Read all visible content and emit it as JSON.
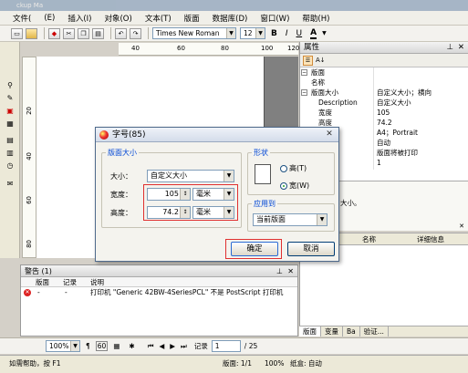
{
  "window": {
    "title_fragment": "ckup Ma"
  },
  "menubar": {
    "items": [
      "文件(",
      "(E)",
      "插入(I)",
      "对象(O)",
      "文本(T)",
      "版面",
      "数据库(D)",
      "窗口(W)",
      "帮助(H)"
    ]
  },
  "toolbar": {
    "font_name": "Times New Roman",
    "font_size": "12",
    "bold": "B",
    "italic": "I",
    "underline": "U",
    "color_a": "A"
  },
  "hruler": {
    "labels": [
      "40",
      "60",
      "80",
      "100",
      "120"
    ]
  },
  "vruler": {
    "labels": [
      "20",
      "40",
      "60",
      "80"
    ]
  },
  "properties": {
    "title": "属性",
    "pin": "ᵃ",
    "close": "✕",
    "rows": [
      {
        "name": "版面",
        "value": "",
        "group": true
      },
      {
        "name": "名称",
        "value": ""
      },
      {
        "name": "版面大小",
        "value": "自定义大小；横向",
        "group": true
      },
      {
        "name": "Description",
        "value": "自定义大小"
      },
      {
        "name": "宽度",
        "value": "105"
      },
      {
        "name": "高度",
        "value": "74.2"
      },
      {
        "name": "",
        "value": "A4；Portrait"
      },
      {
        "name": "",
        "value": "自动"
      },
      {
        "name": "",
        "value": "版面将被打印"
      },
      {
        "name": "",
        "value": "1"
      }
    ],
    "desc_fragment": "大小。"
  },
  "rlower": {
    "col_name": "名称",
    "col_detail": "详细信息",
    "close": "✕"
  },
  "rtabs": [
    "版面",
    "变量",
    "Ba",
    "验证..."
  ],
  "warnings": {
    "title": "警告 (1)",
    "columns": [
      "版面",
      "记录",
      "说明"
    ],
    "row": {
      "page": "-",
      "record": "-",
      "desc": "打印机 \"Generic 42BW-4SeriesPCL\" 不是 PostScript 打印机"
    }
  },
  "bottombar": {
    "zoom": "100%",
    "record_label": "记录",
    "record_value": "1",
    "record_total": "/ 25"
  },
  "statusbar": {
    "help": "如需帮助，按 F1",
    "page": "版面: 1/1",
    "zoom": "100%",
    "paper": "纸盒: 自动"
  },
  "dialog": {
    "title": "字号(85)",
    "close": "✕",
    "page_size_legend": "版面大小",
    "size_label": "大小：",
    "size_value": "自定义大小",
    "width_label": "宽度：",
    "width_value": "105",
    "height_label": "高度：",
    "height_value": "74.2",
    "unit_value": "毫米",
    "shape_legend": "形状",
    "tall_label": "高(T)",
    "wide_label": "宽(W)",
    "apply_legend": "应用到",
    "apply_value": "当前版面",
    "ok": "确定",
    "cancel": "取消"
  },
  "colors": {
    "accent_red": "#e03030",
    "panel": "#ece9d8",
    "dialog_title": "#d4dcea"
  }
}
